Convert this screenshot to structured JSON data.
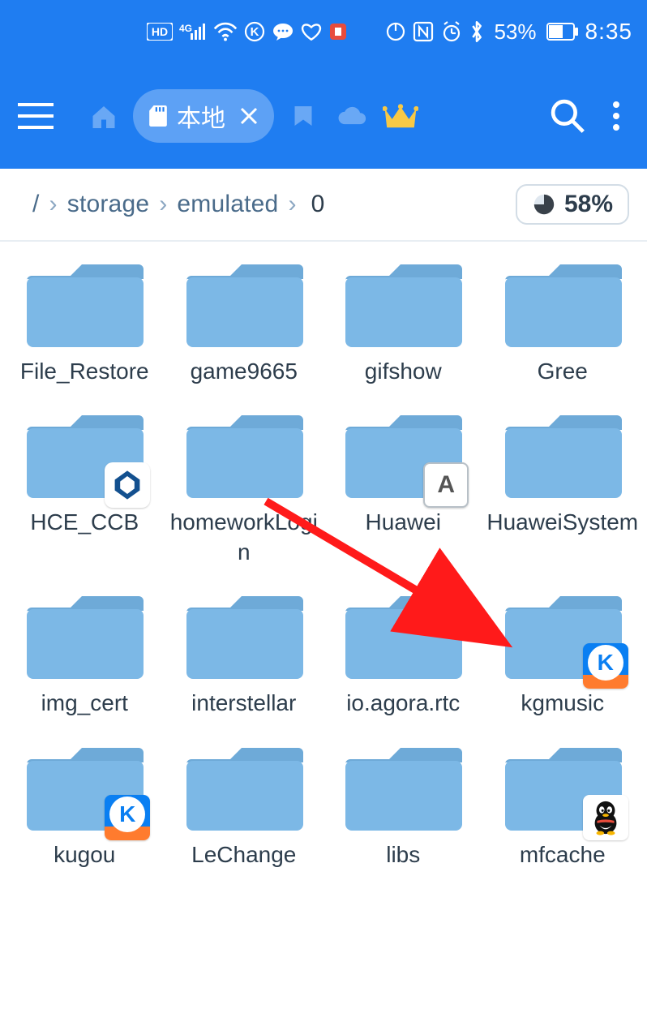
{
  "status": {
    "battery_pct": "53%",
    "clock": "8:35"
  },
  "appbar": {
    "tab_label": "本地"
  },
  "breadcrumb": {
    "root": "/",
    "segs": [
      "storage",
      "emulated"
    ],
    "current": "0",
    "storage_pct": "58%"
  },
  "folders": [
    {
      "name": "File_Restore",
      "overlay": null
    },
    {
      "name": "game9665",
      "overlay": null
    },
    {
      "name": "gifshow",
      "overlay": null
    },
    {
      "name": "Gree",
      "overlay": null
    },
    {
      "name": "HCE_CCB",
      "overlay": "ccb"
    },
    {
      "name": "homeworkLogin",
      "overlay": null
    },
    {
      "name": "Huawei",
      "overlay": "letter-a"
    },
    {
      "name": "HuaweiSystem",
      "overlay": null
    },
    {
      "name": "img_cert",
      "overlay": null
    },
    {
      "name": "interstellar",
      "overlay": null
    },
    {
      "name": "io.agora.rtc",
      "overlay": null
    },
    {
      "name": "kgmusic",
      "overlay": "kugou"
    },
    {
      "name": "kugou",
      "overlay": "kugou"
    },
    {
      "name": "LeChange",
      "overlay": null
    },
    {
      "name": "libs",
      "overlay": null
    },
    {
      "name": "mfcache",
      "overlay": "qq"
    }
  ]
}
